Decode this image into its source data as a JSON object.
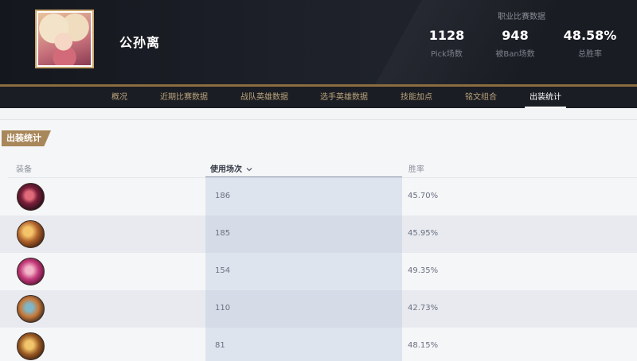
{
  "hero": {
    "name": "公孙离"
  },
  "career_stats": {
    "title": "职业比赛数据",
    "items": [
      {
        "value": "1128",
        "label": "Pick场数"
      },
      {
        "value": "948",
        "label": "被Ban场数"
      },
      {
        "value": "48.58%",
        "label": "总胜率"
      }
    ]
  },
  "tabs": [
    {
      "label": "概况"
    },
    {
      "label": "近期比赛数据"
    },
    {
      "label": "战队英雄数据"
    },
    {
      "label": "选手英雄数据"
    },
    {
      "label": "技能加点"
    },
    {
      "label": "铭文组合"
    },
    {
      "label": "出装统计",
      "active": true
    }
  ],
  "section": {
    "title": "出装统计",
    "columns": {
      "equip": "装备",
      "usage": "使用场次",
      "win_rate": "胜率"
    },
    "rows": [
      {
        "usage": "186",
        "win_rate": "45.70%"
      },
      {
        "usage": "185",
        "win_rate": "45.95%"
      },
      {
        "usage": "154",
        "win_rate": "49.35%"
      },
      {
        "usage": "110",
        "win_rate": "42.73%"
      },
      {
        "usage": "81",
        "win_rate": "48.15%"
      }
    ]
  },
  "colors": {
    "accent_gold": "#a8875a",
    "header_bg": "#1d2029",
    "sort_column_bg": "#dee4ee"
  }
}
